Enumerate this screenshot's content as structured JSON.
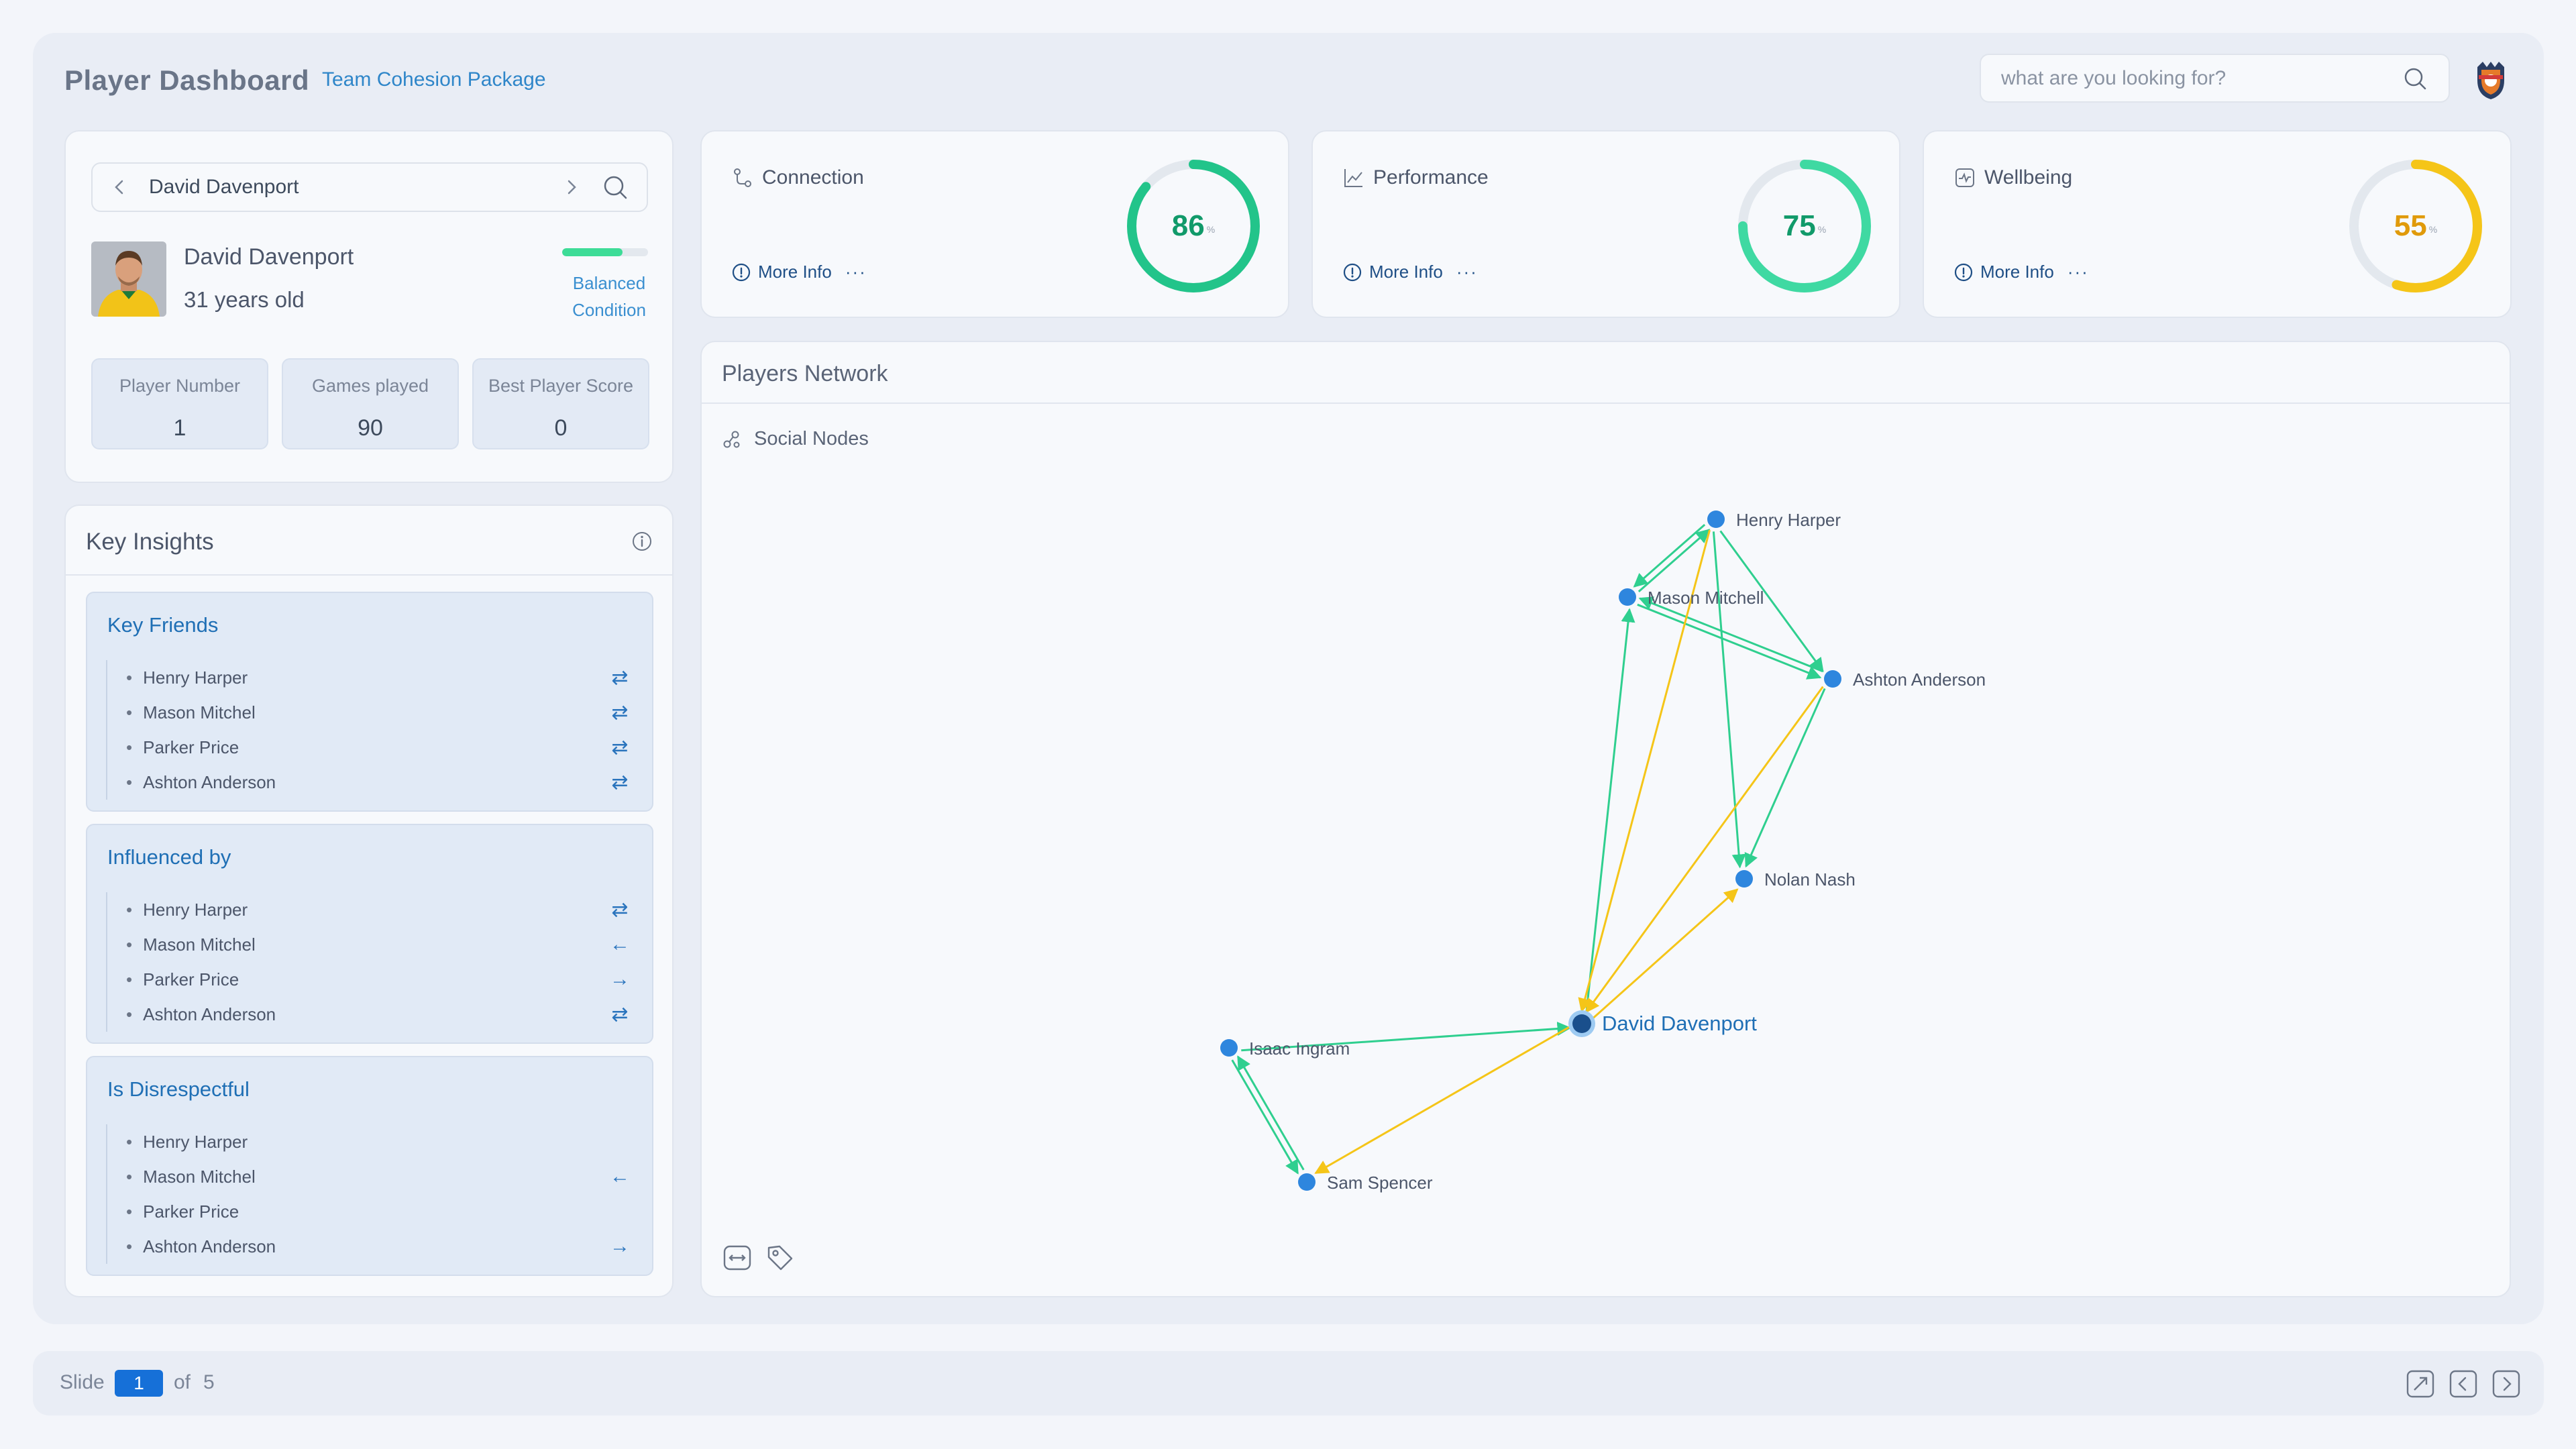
{
  "header": {
    "title": "Player Dashboard",
    "subtitle": "Team Cohesion Package",
    "search_placeholder": "what are you looking for?"
  },
  "player": {
    "selector_name": "David Davenport",
    "name": "David Davenport",
    "age": "31 years old",
    "condition_line1": "Balanced",
    "condition_line2": "Condition",
    "condition_level": 0.7,
    "stats": [
      {
        "label": "Player Number",
        "value": "1"
      },
      {
        "label": "Games played",
        "value": "90"
      },
      {
        "label": "Best Player Score",
        "value": "0"
      }
    ]
  },
  "insights": {
    "title": "Key Insights",
    "groups": [
      {
        "title": "Key Friends",
        "items": [
          {
            "name": "Henry Harper",
            "rel": "⇄"
          },
          {
            "name": "Mason Mitchel",
            "rel": "⇄"
          },
          {
            "name": "Parker Price",
            "rel": "⇄"
          },
          {
            "name": "Ashton Anderson",
            "rel": "⇄"
          }
        ]
      },
      {
        "title": "Influenced by",
        "items": [
          {
            "name": "Henry Harper",
            "rel": "⇄"
          },
          {
            "name": "Mason Mitchel",
            "rel": "←"
          },
          {
            "name": "Parker Price",
            "rel": "→"
          },
          {
            "name": "Ashton Anderson",
            "rel": "⇄"
          }
        ]
      },
      {
        "title": "Is Disrespectful",
        "items": [
          {
            "name": "Henry Harper",
            "rel": ""
          },
          {
            "name": "Mason Mitchel",
            "rel": "←"
          },
          {
            "name": "Parker Price",
            "rel": ""
          },
          {
            "name": "Ashton Anderson",
            "rel": "→"
          }
        ]
      }
    ]
  },
  "metrics": [
    {
      "title": "Connection",
      "more": "More Info",
      "value": "86",
      "percent": 86,
      "unit": "%",
      "color": "#22c48a",
      "text_color": "#119a6a"
    },
    {
      "title": "Performance",
      "more": "More Info",
      "value": "75",
      "percent": 75,
      "unit": "%",
      "color": "#3fd9a2",
      "text_color": "#119a6a"
    },
    {
      "title": "Wellbeing",
      "more": "More Info",
      "value": "55",
      "percent": 55,
      "unit": "%",
      "color": "#f5c518",
      "text_color": "#e09a0a"
    }
  ],
  "network": {
    "title": "Players Network",
    "subtitle": "Social Nodes",
    "nodes": [
      {
        "id": "henry",
        "label": "Henry Harper"
      },
      {
        "id": "mason",
        "label": "Mason Mitchell"
      },
      {
        "id": "ashton",
        "label": "Ashton Anderson"
      },
      {
        "id": "nolan",
        "label": "Nolan Nash"
      },
      {
        "id": "david",
        "label": "David Davenport",
        "focus": true
      },
      {
        "id": "isaac",
        "label": "Isaac Ingram"
      },
      {
        "id": "sam",
        "label": "Sam Spencer"
      }
    ],
    "edges": [
      {
        "from": "mason",
        "to": "henry",
        "type": "green"
      },
      {
        "from": "henry",
        "to": "mason",
        "type": "green"
      },
      {
        "from": "henry",
        "to": "ashton",
        "type": "green"
      },
      {
        "from": "henry",
        "to": "nolan",
        "type": "green"
      },
      {
        "from": "mason",
        "to": "ashton",
        "type": "green"
      },
      {
        "from": "ashton",
        "to": "mason",
        "type": "green"
      },
      {
        "from": "ashton",
        "to": "nolan",
        "type": "green"
      },
      {
        "from": "david",
        "to": "mason",
        "type": "green"
      },
      {
        "from": "henry",
        "to": "david",
        "type": "yellow"
      },
      {
        "from": "ashton",
        "to": "david",
        "type": "yellow"
      },
      {
        "from": "david",
        "to": "nolan",
        "type": "yellow"
      },
      {
        "from": "isaac",
        "to": "david",
        "type": "green"
      },
      {
        "from": "david",
        "to": "sam",
        "type": "yellow"
      },
      {
        "from": "isaac",
        "to": "sam",
        "type": "green"
      },
      {
        "from": "sam",
        "to": "isaac",
        "type": "green"
      }
    ],
    "colors": {
      "node": "#2e86de",
      "green_edge": "#2fcf8f",
      "yellow_edge": "#f5c518",
      "focus_label": "#1f6fb5"
    }
  },
  "footer": {
    "slide_label": "Slide",
    "current": "1",
    "of_label": "of",
    "total": "5"
  }
}
